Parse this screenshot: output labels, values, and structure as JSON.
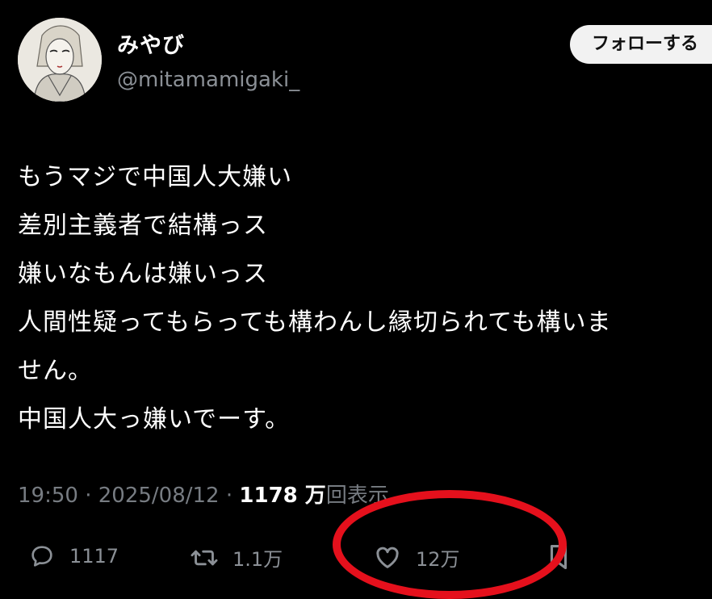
{
  "author": {
    "display_name": "みやび",
    "handle": "@mitamamigaki_"
  },
  "follow_button": {
    "label": "フォローする"
  },
  "tweet": {
    "lines": [
      "もうマジで中国人大嫌い",
      "差別主義者で結構っス",
      "嫌いなもんは嫌いっス",
      "人間性疑ってもらっても構わんし縁切られても構いま",
      "せん。",
      "中国人大っ嫌いでーす。"
    ]
  },
  "meta": {
    "time": "19:50",
    "separator": " · ",
    "date": "2025/08/12",
    "views": "1178 万",
    "views_suffix": "回表示"
  },
  "actions": {
    "replies": "1117",
    "retweets": "1.1万",
    "likes": "12万"
  },
  "icons": {
    "reply": "speech-bubble-icon",
    "retweet": "retweet-arrows-icon",
    "like": "heart-icon",
    "bookmark": "bookmark-icon"
  },
  "colors": {
    "background": "#000000",
    "text": "#ffffff",
    "muted": "#8b9096",
    "annotation": "#e5101c"
  }
}
